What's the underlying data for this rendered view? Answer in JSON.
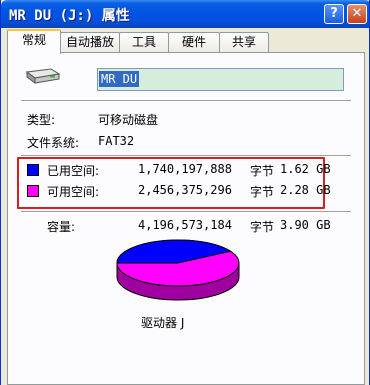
{
  "window": {
    "title": "MR DU (J:) 属性",
    "help_label": "?",
    "close_label": "✕"
  },
  "tabs": [
    {
      "label": "常规",
      "active": true
    },
    {
      "label": "自动播放",
      "active": false
    },
    {
      "label": "工具",
      "active": false
    },
    {
      "label": "硬件",
      "active": false
    },
    {
      "label": "共享",
      "active": false
    }
  ],
  "general": {
    "drive_name_value": "MR DU",
    "type_label": "类型:",
    "type_value": "可移动磁盘",
    "fs_label": "文件系统:",
    "fs_value": "FAT32",
    "used": {
      "label": "已用空间:",
      "bytes": "1,740,197,888",
      "unit": "字节",
      "size": "1.62 GB",
      "color": "#0000ff"
    },
    "free": {
      "label": "可用空间:",
      "bytes": "2,456,375,296",
      "unit": "字节",
      "size": "2.28 GB",
      "color": "#ff00ff"
    },
    "capacity": {
      "label": "容量:",
      "bytes": "4,196,573,184",
      "unit": "字节",
      "size": "3.90 GB"
    },
    "drive_label": "驱动器 J",
    "used_fraction": 0.415
  },
  "colors": {
    "highlight_border": "#d42020",
    "titlebar": "#0054e3"
  }
}
